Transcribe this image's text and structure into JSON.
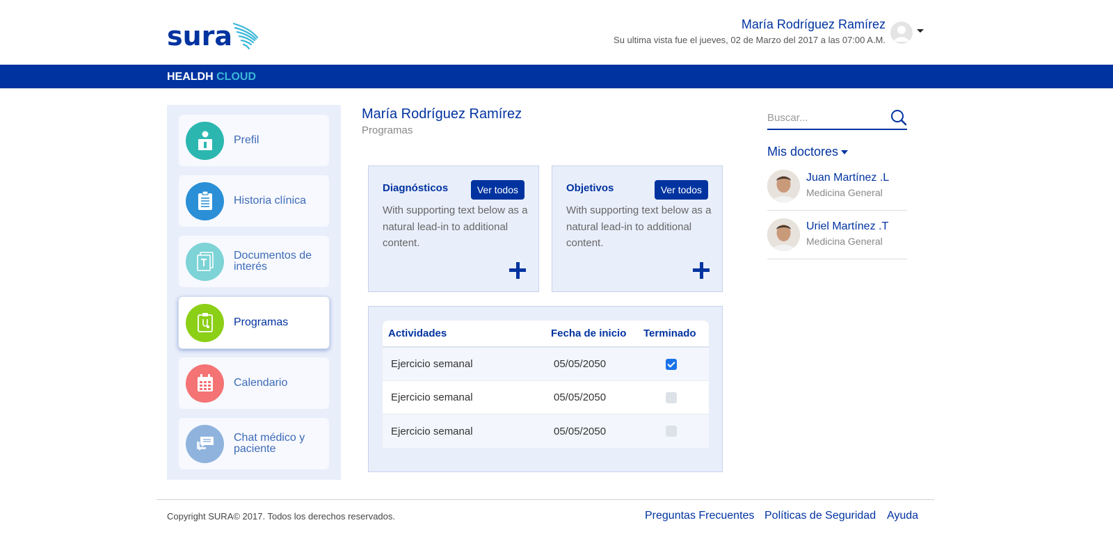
{
  "brand": {
    "logo_text": "sura",
    "band_word1": "HEALDH",
    "band_word2": "CLOUD",
    "colors": {
      "primary": "#0033a0",
      "accent": "#3bb7d8"
    }
  },
  "user": {
    "name": "María Rodríguez Ramírez",
    "last_visit": "Su ultima vista fue el jueves, 02 de Marzo del 2017 a las 07:00 A.M."
  },
  "sidebar": {
    "items": [
      {
        "label": "Prefil",
        "icon": "id-badge-icon",
        "color": "#2bb7b0"
      },
      {
        "label": "Historia clínica",
        "icon": "clipboard-icon",
        "color": "#2a8fd6"
      },
      {
        "label": "Documentos de interés",
        "icon": "documents-icon",
        "color": "#7dd3d6"
      },
      {
        "label": "Programas",
        "icon": "program-clipboard-icon",
        "color": "#8ccf17",
        "active": true
      },
      {
        "label": "Calendario",
        "icon": "calendar-icon",
        "color": "#f47374"
      },
      {
        "label": "Chat médico y paciente",
        "icon": "chat-icon",
        "color": "#8fb3dd"
      }
    ]
  },
  "main": {
    "title": "María Rodríguez Ramírez",
    "subtitle": "Programas",
    "cards": [
      {
        "title": "Diagnósticos",
        "button": "Ver todos",
        "text": "With supporting text below as a natural lead-in to additional content."
      },
      {
        "title": "Objetivos",
        "button": "Ver todos",
        "text": "With supporting text below as a natural lead-in to additional content."
      }
    ],
    "table": {
      "headers": [
        "Actividades",
        "Fecha de inicio",
        "Terminado"
      ],
      "rows": [
        {
          "activity": "Ejercicio semanal",
          "date": "05/05/2050",
          "done": true
        },
        {
          "activity": "Ejercicio semanal",
          "date": "05/05/2050",
          "done": false
        },
        {
          "activity": "Ejercicio semanal",
          "date": "05/05/2050",
          "done": false
        }
      ]
    }
  },
  "search": {
    "placeholder": "Buscar..."
  },
  "doctors": {
    "title": "Mis doctores",
    "items": [
      {
        "name": "Juan Martínez .L",
        "specialty": "Medicina General"
      },
      {
        "name": "Uriel Martínez .T",
        "specialty": "Medicina General"
      }
    ]
  },
  "footer": {
    "copyright": "Copyright SURA© 2017. Todos los derechos reservados.",
    "links": [
      "Preguntas Frecuentes",
      "Políticas de Seguridad",
      "Ayuda"
    ]
  }
}
